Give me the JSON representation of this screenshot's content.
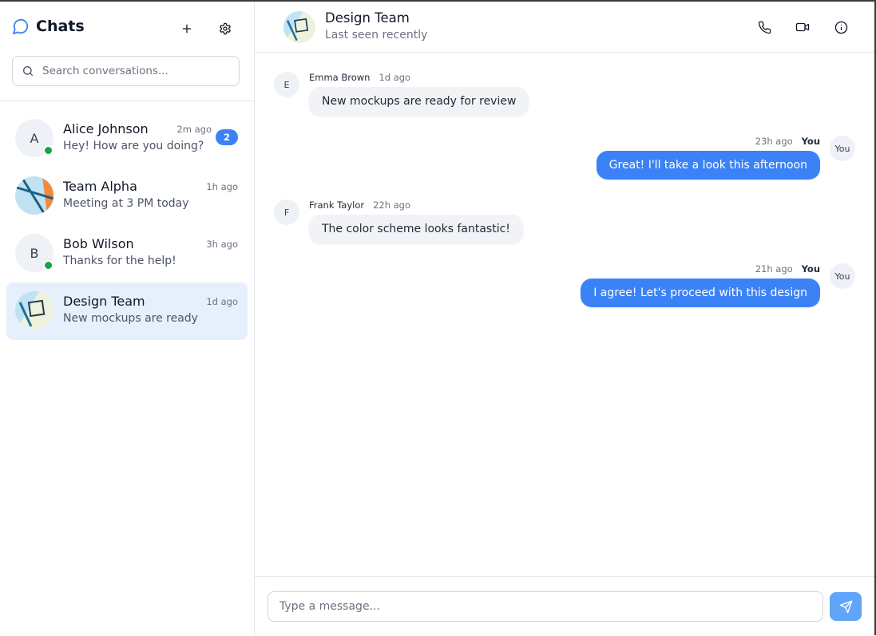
{
  "sidebar": {
    "title": "Chats",
    "new_chat_icon": "plus-icon",
    "settings_icon": "gear-icon",
    "search": {
      "placeholder": "Search conversations..."
    },
    "conversations": [
      {
        "name": "Alice Johnson",
        "preview": "Hey! How are you doing?",
        "time": "2m ago",
        "initial": "A",
        "online": true,
        "unread": "2",
        "active": false
      },
      {
        "name": "Team Alpha",
        "preview": "Meeting at 3 PM today",
        "time": "1h ago",
        "initial": "",
        "online": false,
        "unread": "",
        "active": false
      },
      {
        "name": "Bob Wilson",
        "preview": "Thanks for the help!",
        "time": "3h ago",
        "initial": "B",
        "online": true,
        "unread": "",
        "active": false
      },
      {
        "name": "Design Team",
        "preview": "New mockups are ready",
        "time": "1d ago",
        "initial": "",
        "online": false,
        "unread": "",
        "active": true
      }
    ]
  },
  "chat": {
    "name": "Design Team",
    "status": "Last seen recently",
    "actions": [
      "phone-icon",
      "video-icon",
      "info-icon"
    ],
    "messages": [
      {
        "sender": "Emma Brown",
        "initial": "E",
        "time": "1d ago",
        "text": "New mockups are ready for review",
        "outgoing": false
      },
      {
        "sender": "You",
        "initial": "You",
        "time": "23h ago",
        "text": "Great! I'll take a look this afternoon",
        "outgoing": true
      },
      {
        "sender": "Frank Taylor",
        "initial": "F",
        "time": "22h ago",
        "text": "The color scheme looks fantastic!",
        "outgoing": false
      },
      {
        "sender": "You",
        "initial": "You",
        "time": "21h ago",
        "text": "I agree! Let's proceed with this design",
        "outgoing": true
      }
    ],
    "composer": {
      "placeholder": "Type a message..."
    }
  },
  "colors": {
    "accent": "#3b82f6",
    "active_bg": "#e6f0fd",
    "online": "#16a34a"
  }
}
